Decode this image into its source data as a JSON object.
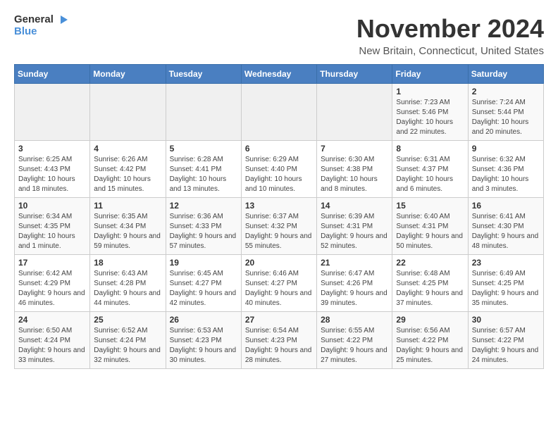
{
  "logo": {
    "line1": "General",
    "line2": "Blue"
  },
  "title": "November 2024",
  "subtitle": "New Britain, Connecticut, United States",
  "weekdays": [
    "Sunday",
    "Monday",
    "Tuesday",
    "Wednesday",
    "Thursday",
    "Friday",
    "Saturday"
  ],
  "weeks": [
    [
      {
        "day": "",
        "info": ""
      },
      {
        "day": "",
        "info": ""
      },
      {
        "day": "",
        "info": ""
      },
      {
        "day": "",
        "info": ""
      },
      {
        "day": "",
        "info": ""
      },
      {
        "day": "1",
        "info": "Sunrise: 7:23 AM\nSunset: 5:46 PM\nDaylight: 10 hours and 22 minutes."
      },
      {
        "day": "2",
        "info": "Sunrise: 7:24 AM\nSunset: 5:44 PM\nDaylight: 10 hours and 20 minutes."
      }
    ],
    [
      {
        "day": "3",
        "info": "Sunrise: 6:25 AM\nSunset: 4:43 PM\nDaylight: 10 hours and 18 minutes."
      },
      {
        "day": "4",
        "info": "Sunrise: 6:26 AM\nSunset: 4:42 PM\nDaylight: 10 hours and 15 minutes."
      },
      {
        "day": "5",
        "info": "Sunrise: 6:28 AM\nSunset: 4:41 PM\nDaylight: 10 hours and 13 minutes."
      },
      {
        "day": "6",
        "info": "Sunrise: 6:29 AM\nSunset: 4:40 PM\nDaylight: 10 hours and 10 minutes."
      },
      {
        "day": "7",
        "info": "Sunrise: 6:30 AM\nSunset: 4:38 PM\nDaylight: 10 hours and 8 minutes."
      },
      {
        "day": "8",
        "info": "Sunrise: 6:31 AM\nSunset: 4:37 PM\nDaylight: 10 hours and 6 minutes."
      },
      {
        "day": "9",
        "info": "Sunrise: 6:32 AM\nSunset: 4:36 PM\nDaylight: 10 hours and 3 minutes."
      }
    ],
    [
      {
        "day": "10",
        "info": "Sunrise: 6:34 AM\nSunset: 4:35 PM\nDaylight: 10 hours and 1 minute."
      },
      {
        "day": "11",
        "info": "Sunrise: 6:35 AM\nSunset: 4:34 PM\nDaylight: 9 hours and 59 minutes."
      },
      {
        "day": "12",
        "info": "Sunrise: 6:36 AM\nSunset: 4:33 PM\nDaylight: 9 hours and 57 minutes."
      },
      {
        "day": "13",
        "info": "Sunrise: 6:37 AM\nSunset: 4:32 PM\nDaylight: 9 hours and 55 minutes."
      },
      {
        "day": "14",
        "info": "Sunrise: 6:39 AM\nSunset: 4:31 PM\nDaylight: 9 hours and 52 minutes."
      },
      {
        "day": "15",
        "info": "Sunrise: 6:40 AM\nSunset: 4:31 PM\nDaylight: 9 hours and 50 minutes."
      },
      {
        "day": "16",
        "info": "Sunrise: 6:41 AM\nSunset: 4:30 PM\nDaylight: 9 hours and 48 minutes."
      }
    ],
    [
      {
        "day": "17",
        "info": "Sunrise: 6:42 AM\nSunset: 4:29 PM\nDaylight: 9 hours and 46 minutes."
      },
      {
        "day": "18",
        "info": "Sunrise: 6:43 AM\nSunset: 4:28 PM\nDaylight: 9 hours and 44 minutes."
      },
      {
        "day": "19",
        "info": "Sunrise: 6:45 AM\nSunset: 4:27 PM\nDaylight: 9 hours and 42 minutes."
      },
      {
        "day": "20",
        "info": "Sunrise: 6:46 AM\nSunset: 4:27 PM\nDaylight: 9 hours and 40 minutes."
      },
      {
        "day": "21",
        "info": "Sunrise: 6:47 AM\nSunset: 4:26 PM\nDaylight: 9 hours and 39 minutes."
      },
      {
        "day": "22",
        "info": "Sunrise: 6:48 AM\nSunset: 4:25 PM\nDaylight: 9 hours and 37 minutes."
      },
      {
        "day": "23",
        "info": "Sunrise: 6:49 AM\nSunset: 4:25 PM\nDaylight: 9 hours and 35 minutes."
      }
    ],
    [
      {
        "day": "24",
        "info": "Sunrise: 6:50 AM\nSunset: 4:24 PM\nDaylight: 9 hours and 33 minutes."
      },
      {
        "day": "25",
        "info": "Sunrise: 6:52 AM\nSunset: 4:24 PM\nDaylight: 9 hours and 32 minutes."
      },
      {
        "day": "26",
        "info": "Sunrise: 6:53 AM\nSunset: 4:23 PM\nDaylight: 9 hours and 30 minutes."
      },
      {
        "day": "27",
        "info": "Sunrise: 6:54 AM\nSunset: 4:23 PM\nDaylight: 9 hours and 28 minutes."
      },
      {
        "day": "28",
        "info": "Sunrise: 6:55 AM\nSunset: 4:22 PM\nDaylight: 9 hours and 27 minutes."
      },
      {
        "day": "29",
        "info": "Sunrise: 6:56 AM\nSunset: 4:22 PM\nDaylight: 9 hours and 25 minutes."
      },
      {
        "day": "30",
        "info": "Sunrise: 6:57 AM\nSunset: 4:22 PM\nDaylight: 9 hours and 24 minutes."
      }
    ]
  ]
}
